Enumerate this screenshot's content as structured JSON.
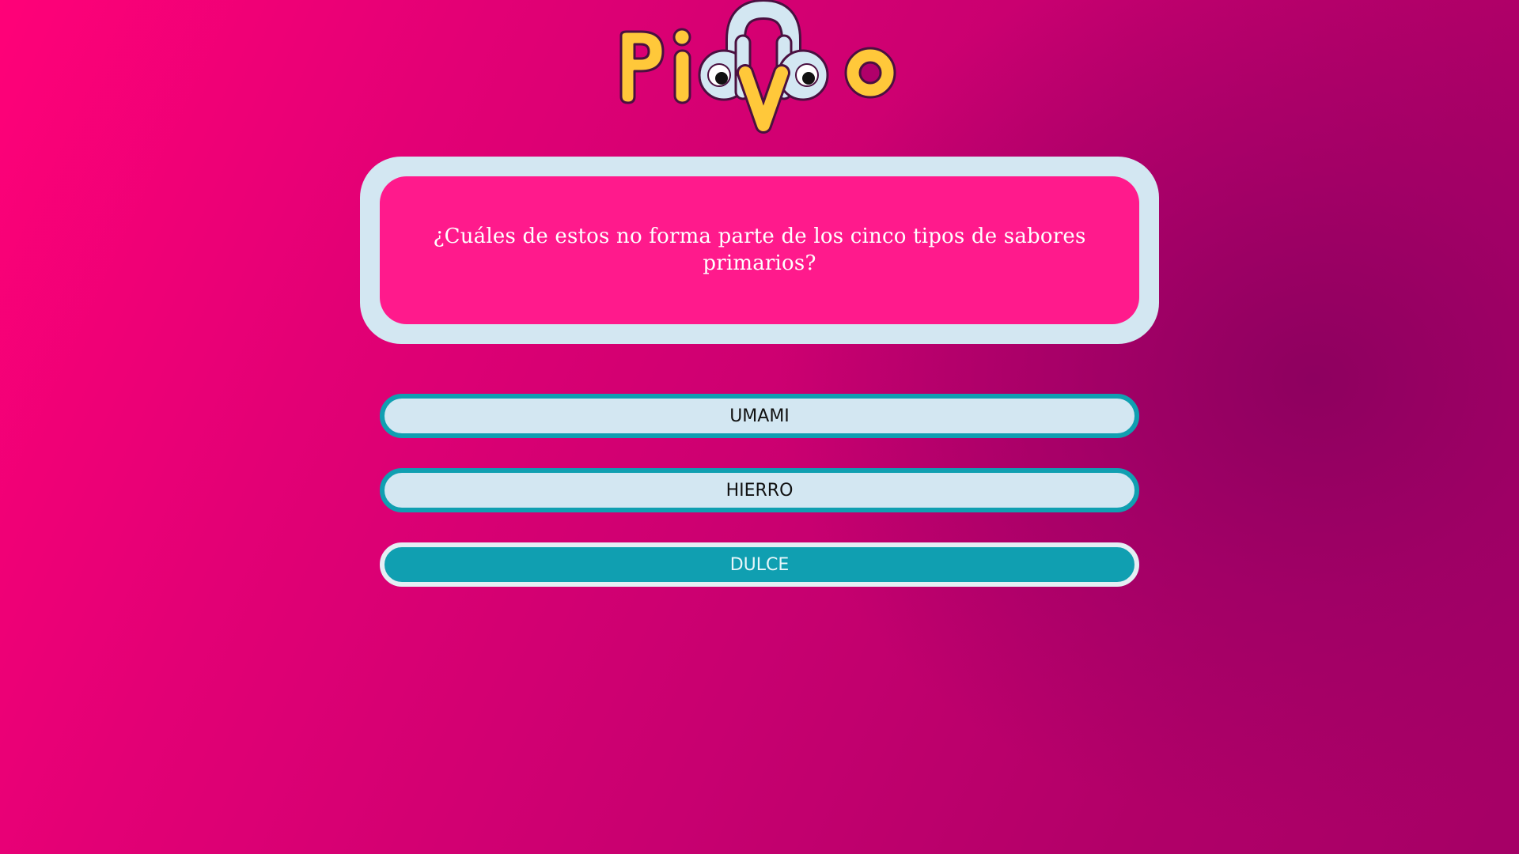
{
  "app": {
    "logo_text": "Piduvo"
  },
  "colors": {
    "background_start": "#ff0178",
    "background_end": "#a50066",
    "question_frame": "#d3e7f2",
    "question_fill": "#ff1a8c",
    "answer_fill": "#d3e7f2",
    "answer_border": "#109fb1",
    "answer_selected_fill": "#109fb1",
    "logo_yellow": "#ffc83a",
    "logo_blue": "#d3e7f2"
  },
  "question": {
    "text": "¿Cuáles de estos no forma parte de los cinco tipos de sabores primarios?"
  },
  "answers": [
    {
      "label": "UMAMI",
      "selected": false
    },
    {
      "label": "HIERRO",
      "selected": false
    },
    {
      "label": "DULCE",
      "selected": true
    }
  ]
}
